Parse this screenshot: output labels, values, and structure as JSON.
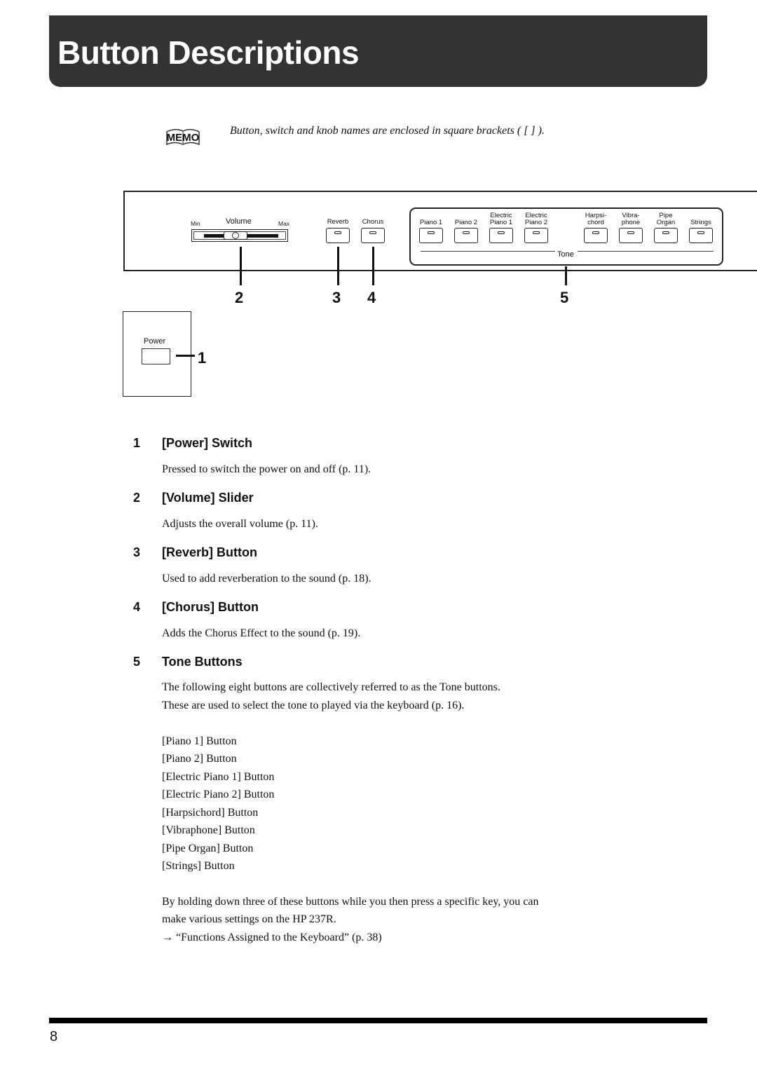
{
  "header": {
    "title": "Button Descriptions"
  },
  "memo": {
    "icon": "memo-icon",
    "icon_text": "MEMO",
    "note": "Button, switch and knob names are enclosed in square brackets ( [ ] )."
  },
  "panel": {
    "volume": {
      "label": "Volume",
      "min_label": "Min",
      "max_label": "Max",
      "level_fraction": 0.45
    },
    "reverb_label": "Reverb",
    "chorus_label": "Chorus",
    "tone_group_label": "Tone",
    "tone_buttons": [
      {
        "line1": "",
        "line2": "Piano 1"
      },
      {
        "line1": "",
        "line2": "Piano 2"
      },
      {
        "line1": "Electric",
        "line2": "Piano 1"
      },
      {
        "line1": "Electric",
        "line2": "Piano 2"
      },
      {
        "line1": "Harpsi-",
        "line2": "chord"
      },
      {
        "line1": "Vibra-",
        "line2": "phone"
      },
      {
        "line1": "Pipe",
        "line2": "Organ"
      },
      {
        "line1": "",
        "line2": "Strings"
      }
    ],
    "power_label": "Power",
    "callouts": [
      "1",
      "2",
      "3",
      "4",
      "5"
    ]
  },
  "items": [
    {
      "num": "1",
      "heading": "[Power] Switch",
      "body": "Pressed to switch the power on and off (p. 11)."
    },
    {
      "num": "2",
      "heading": "[Volume] Slider",
      "body": "Adjusts the overall volume (p. 11)."
    },
    {
      "num": "3",
      "heading": "[Reverb] Button",
      "body": "Used to add reverberation to the sound (p. 18)."
    },
    {
      "num": "4",
      "heading": "[Chorus] Button",
      "body": "Adds the Chorus Effect to the sound (p. 19)."
    },
    {
      "num": "5",
      "heading": "Tone Buttons",
      "body_lines": [
        "The following eight buttons are collectively referred to as the Tone buttons.",
        "These are used to select the tone to played via the keyboard (p. 16)."
      ]
    }
  ],
  "tone_list": [
    "[Piano 1] Button",
    "[Piano 2] Button",
    "[Electric Piano 1] Button",
    "[Electric Piano 2] Button",
    "[Harpsichord] Button",
    "[Vibraphone] Button",
    "[Pipe Organ] Button",
    "[Strings] Button"
  ],
  "closing": {
    "lines": [
      "By holding down three of these buttons while you then press a specific key, you can",
      "make various settings on the HP 237R."
    ],
    "reference_arrow": "→",
    "reference": "“Functions Assigned to the Keyboard” (p. 38)"
  },
  "footer": {
    "page_number": "8"
  }
}
